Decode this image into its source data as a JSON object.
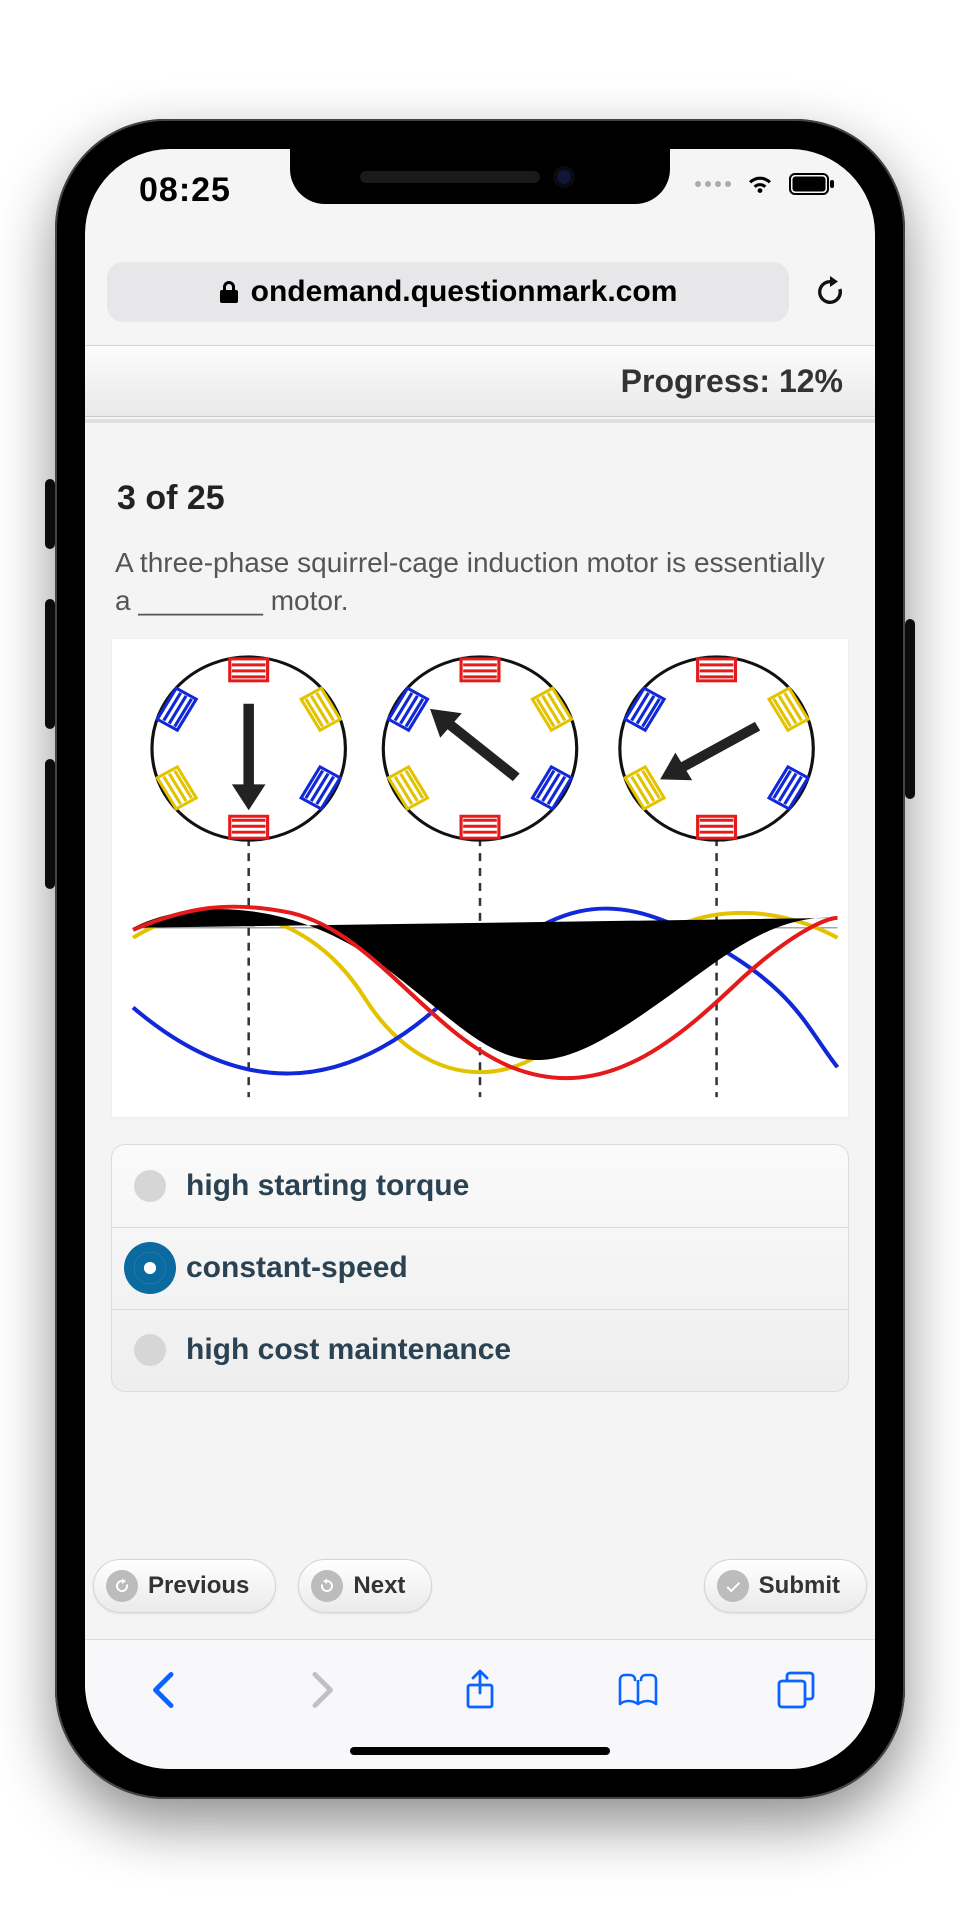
{
  "status": {
    "time": "08:25"
  },
  "url": {
    "domain": "ondemand.questionmark.com"
  },
  "progress": {
    "label": "Progress: 12%"
  },
  "question": {
    "counter": "3 of 25",
    "text": "A three-phase squirrel-cage induction motor is essentially a ________ motor."
  },
  "options": [
    {
      "label": "high starting torque",
      "selected": false
    },
    {
      "label": "constant-speed",
      "selected": true
    },
    {
      "label": "high cost maintenance",
      "selected": false
    }
  ],
  "nav": {
    "previous": "Previous",
    "next": "Next",
    "submit": "Submit"
  }
}
